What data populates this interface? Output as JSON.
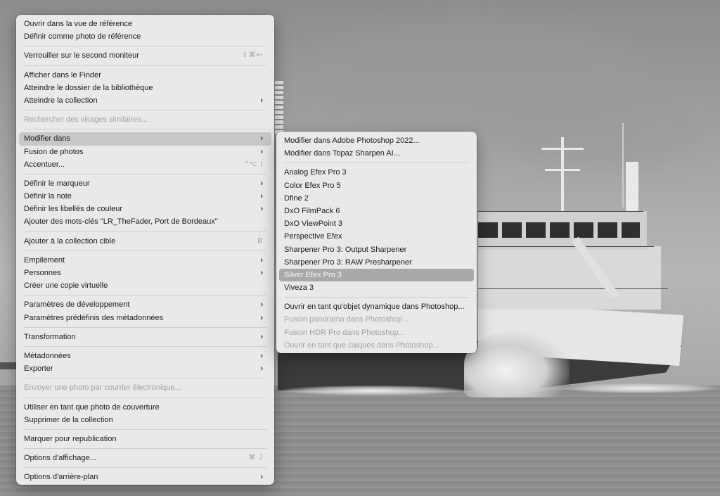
{
  "main_menu": {
    "groups": [
      {
        "items": [
          {
            "label": "Ouvrir dans la vue de référence"
          },
          {
            "label": "Définir comme photo de référence"
          }
        ]
      },
      {
        "items": [
          {
            "label": "Verrouiller sur le second moniteur",
            "shortcut": "⇧⌘↩"
          }
        ]
      },
      {
        "items": [
          {
            "label": "Afficher dans le Finder"
          },
          {
            "label": "Atteindre le dossier de la bibliothèque"
          },
          {
            "label": "Atteindre la collection",
            "submenu": true
          }
        ]
      },
      {
        "items": [
          {
            "label": "Rechercher des visages similaires...",
            "disabled": true
          }
        ]
      },
      {
        "items": [
          {
            "label": "Modifier dans",
            "submenu": true,
            "highlight": true
          },
          {
            "label": "Fusion de photos",
            "submenu": true
          },
          {
            "label": "Accentuer...",
            "shortcut": "^⌥ I"
          }
        ]
      },
      {
        "items": [
          {
            "label": "Définir le marqueur",
            "submenu": true
          },
          {
            "label": "Définir la note",
            "submenu": true
          },
          {
            "label": "Définir les libellés de couleur",
            "submenu": true
          },
          {
            "label": "Ajouter des mots-clés \"LR_TheFader, Port de Bordeaux\""
          }
        ]
      },
      {
        "items": [
          {
            "label": "Ajouter à la collection cible",
            "shortcut": "B"
          }
        ]
      },
      {
        "items": [
          {
            "label": "Empilement",
            "submenu": true
          },
          {
            "label": "Personnes",
            "submenu": true
          },
          {
            "label": "Créer une copie virtuelle"
          }
        ]
      },
      {
        "items": [
          {
            "label": "Paramètres de développement",
            "submenu": true
          },
          {
            "label": "Paramètres prédéfinis des métadonnées",
            "submenu": true
          }
        ]
      },
      {
        "items": [
          {
            "label": "Transformation",
            "submenu": true
          }
        ]
      },
      {
        "items": [
          {
            "label": "Métadonnées",
            "submenu": true
          },
          {
            "label": "Exporter",
            "submenu": true
          }
        ]
      },
      {
        "items": [
          {
            "label": "Envoyer une photo par courrier électronique...",
            "disabled": true
          }
        ]
      },
      {
        "items": [
          {
            "label": "Utiliser en tant que photo de couverture"
          },
          {
            "label": "Supprimer de la collection"
          }
        ]
      },
      {
        "items": [
          {
            "label": "Marquer pour republication"
          }
        ]
      },
      {
        "items": [
          {
            "label": "Options d'affichage...",
            "shortcut": "⌘ J"
          }
        ]
      },
      {
        "items": [
          {
            "label": "Options d'arrière-plan",
            "submenu": true
          }
        ]
      }
    ]
  },
  "submenu_modifier_dans": {
    "groups": [
      {
        "items": [
          {
            "label": "Modifier dans Adobe Photoshop 2022..."
          },
          {
            "label": "Modifier dans Topaz Sharpen AI..."
          }
        ]
      },
      {
        "items": [
          {
            "label": "Analog Efex Pro 3"
          },
          {
            "label": "Color Efex Pro 5"
          },
          {
            "label": "Dfine 2"
          },
          {
            "label": "DxO FilmPack 6"
          },
          {
            "label": "DxO ViewPoint 3"
          },
          {
            "label": "Perspective Efex"
          },
          {
            "label": "Sharpener Pro 3: Output Sharpener"
          },
          {
            "label": "Sharpener Pro 3: RAW Presharpener"
          },
          {
            "label": "Silver Efex Pro 3",
            "highlight": true
          },
          {
            "label": "Viveza 3"
          }
        ]
      },
      {
        "items": [
          {
            "label": "Ouvrir en tant qu'objet dynamique dans Photoshop..."
          },
          {
            "label": "Fusion panorama dans Photoshop...",
            "disabled": true
          },
          {
            "label": "Fusion HDR Pro dans Photoshop...",
            "disabled": true
          },
          {
            "label": "Ouvrir en tant que calques dans Photoshop...",
            "disabled": true
          }
        ]
      }
    ]
  },
  "icons": {
    "submenu_indicator": "chevron-right-icon"
  }
}
